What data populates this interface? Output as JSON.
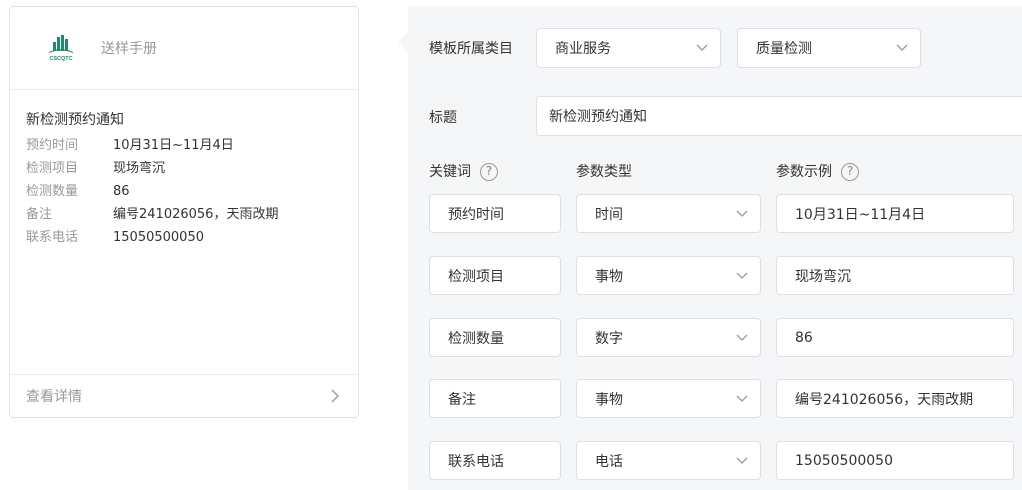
{
  "card": {
    "brand": "送样手册",
    "title": "新检测预约通知",
    "rows": [
      {
        "key": "预约时间",
        "value": "10月31日~11月4日"
      },
      {
        "key": "检测项目",
        "value": "现场弯沉"
      },
      {
        "key": "检测数量",
        "value": "86"
      },
      {
        "key": "备注",
        "value": "编号241026056，天雨改期"
      },
      {
        "key": "联系电话",
        "value": "15050500050"
      }
    ],
    "footer_label": "查看详情",
    "logo_text": "CSCQTC"
  },
  "form": {
    "category_label": "模板所属类目",
    "category_primary": "商业服务",
    "category_secondary": "质量检测",
    "title_label": "标题",
    "title_value": "新检测预约通知",
    "col_keyword": "关键词",
    "col_param_type": "参数类型",
    "col_param_example": "参数示例",
    "help_glyph": "?",
    "params": [
      {
        "keyword": "预约时间",
        "type": "时间",
        "example": "10月31日~11月4日"
      },
      {
        "keyword": "检测项目",
        "type": "事物",
        "example": "现场弯沉"
      },
      {
        "keyword": "检测数量",
        "type": "数字",
        "example": "86"
      },
      {
        "keyword": "备注",
        "type": "事物",
        "example": "编号241026056，天雨改期"
      },
      {
        "keyword": "联系电话",
        "type": "电话",
        "example": "15050500050"
      }
    ]
  },
  "colors": {
    "logo_green": "#1f8a6e",
    "panel_bg": "#f5f6f7",
    "border": "#dcdfe6",
    "muted_text": "#999999"
  }
}
